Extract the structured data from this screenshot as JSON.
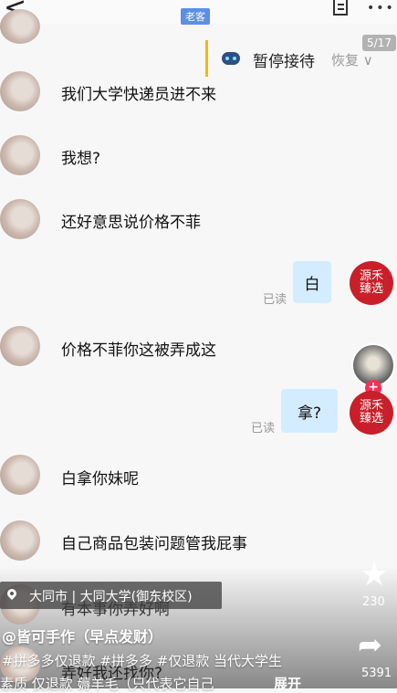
{
  "header": {
    "badge": "老客",
    "back_glyph": "<",
    "more_glyph": "•••"
  },
  "reception": {
    "pause_label": "暂停接待",
    "resume_label": "恢复"
  },
  "counter": "5/17",
  "messages": [
    {
      "side": "left",
      "text": "我们大学快递员进不来"
    },
    {
      "side": "left",
      "text": "我想?"
    },
    {
      "side": "left",
      "text": "还好意思说价格不菲"
    },
    {
      "side": "right",
      "text": "白",
      "status": "已读"
    },
    {
      "side": "left",
      "text": "价格不菲你这被弄成这"
    },
    {
      "side": "right",
      "text": "拿?",
      "status": "已读"
    },
    {
      "side": "left",
      "text": "白拿你妹呢"
    },
    {
      "side": "left",
      "text": "自己商品包装问题管我屁事"
    },
    {
      "side": "left",
      "text": "有本事你弄好啊"
    },
    {
      "side": "left",
      "text": "弄好我还找你?"
    }
  ],
  "shop": {
    "avatar_text": "源禾\n臻选"
  },
  "overlay": {
    "location": "大同市 | 大同大学(御东校区)",
    "account": "@皆可手作（早点发财）",
    "tags": "#拼多多仅退款 #拼多多 #仅退款 当代大学生",
    "description": "素质 仅退款 薅羊毛（只代表它自己",
    "expand": "展开",
    "star_count": "230",
    "share_count": "5391"
  },
  "colors": {
    "badge": "#5b8fe6",
    "right_bubble": "#d4ecff",
    "pause_accent": "#f5b800",
    "shop_avatar": "#c81f2a",
    "follow": "#ff2d55"
  },
  "icons": [
    "back-icon",
    "doc-icon",
    "more-icon",
    "robot-icon",
    "chevron-down-icon",
    "location-pin-icon",
    "star-icon",
    "share-icon",
    "plus-icon"
  ]
}
